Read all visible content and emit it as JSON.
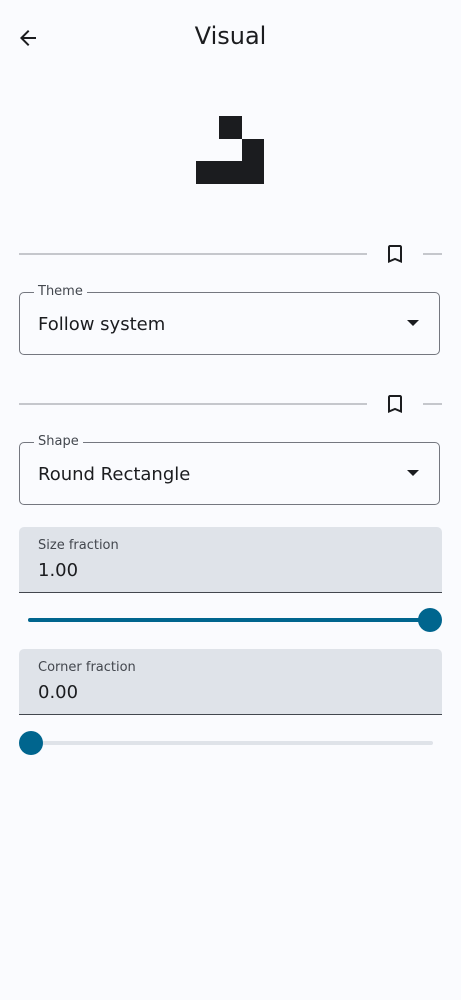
{
  "header": {
    "title": "Visual",
    "back_icon": "arrow-back-icon"
  },
  "preview": {
    "icon": "shape-preview-glyph",
    "color": "#1b1c1f"
  },
  "theme_section": {
    "bookmark_icon": "bookmark-outline-icon",
    "label": "Theme",
    "value": "Follow system"
  },
  "shape_section": {
    "bookmark_icon": "bookmark-outline-icon",
    "label": "Shape",
    "value": "Round Rectangle"
  },
  "size_fraction": {
    "label": "Size fraction",
    "value": "1.00",
    "slider_value": 1.0
  },
  "corner_fraction": {
    "label": "Corner fraction",
    "value": "0.00",
    "slider_value": 0.0
  },
  "colors": {
    "accent": "#00658e",
    "background": "#fafbfe",
    "field_fill": "#dfe3e9",
    "outline": "#74777f"
  }
}
